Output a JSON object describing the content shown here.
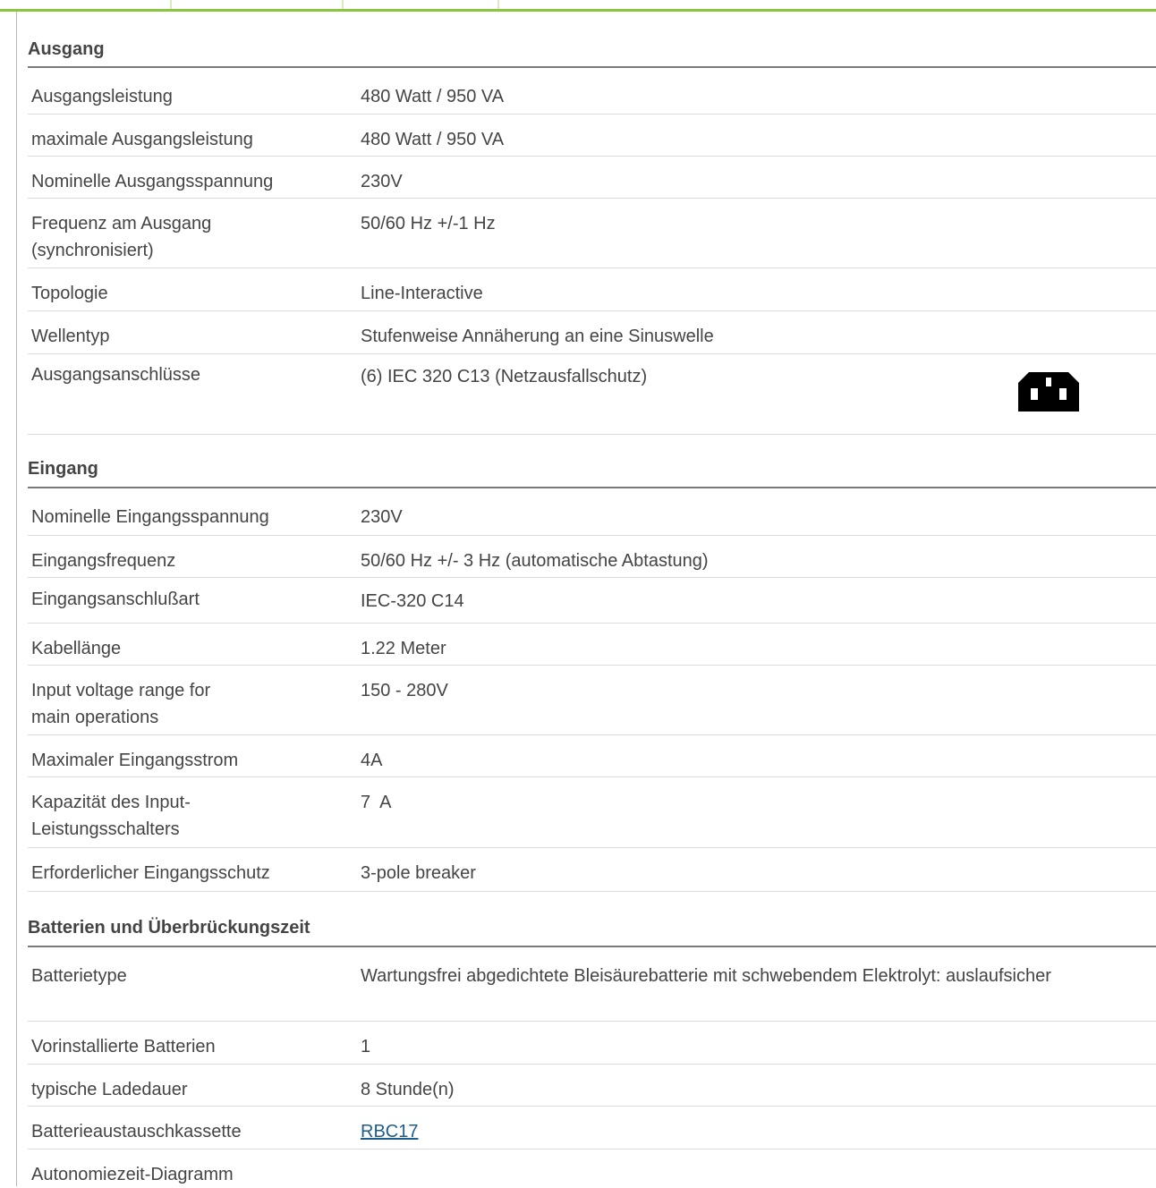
{
  "sections": [
    {
      "title": "Ausgang",
      "rows": [
        {
          "label": "Ausgangsleistung",
          "value": "480 Watt / 950 VA"
        },
        {
          "label": "maximale Ausgangsleistung",
          "value": "480 Watt / 950 VA"
        },
        {
          "label": "Nominelle Ausgangsspannung",
          "value": "230V"
        },
        {
          "label": "Frequenz am Ausgang (synchronisiert)",
          "value": "50/60 Hz +/-1 Hz"
        },
        {
          "label": "Topologie",
          "value": "Line-Interactive"
        },
        {
          "label": "Wellentyp",
          "value": "Stufenweise Annäherung an eine Sinuswelle"
        },
        {
          "label": "Ausgangsanschlüsse",
          "value": "(6) IEC 320 C13 (Netzausfallschutz)",
          "icon": "iec-c13-outlet-icon"
        }
      ]
    },
    {
      "title": "Eingang",
      "rows": [
        {
          "label": "Nominelle Eingangsspannung",
          "value": "230V"
        },
        {
          "label": "Eingangsfrequenz",
          "value": "50/60 Hz +/- 3 Hz (automatische Abtastung)"
        },
        {
          "label": "Eingangsanschlußart",
          "value": "IEC-320 C14"
        },
        {
          "label": "Kabellänge",
          "value": "1.22 Meter"
        },
        {
          "label": "Input voltage range for main operations",
          "value": "150 - 280V"
        },
        {
          "label": "Maximaler Eingangsstrom",
          "value": "4A"
        },
        {
          "label": "Kapazität des Input-Leistungsschalters",
          "value": "7  A"
        },
        {
          "label": "Erforderlicher Eingangsschutz",
          "value": "3-pole breaker"
        }
      ]
    },
    {
      "title": "Batterien und Überbrückungszeit",
      "rows": [
        {
          "label": "Batterietype",
          "value": "Wartungsfrei abgedichtete Bleisäurebatterie mit schwebendem Elektrolyt: auslaufsicher"
        },
        {
          "label": "Vorinstallierte Batterien",
          "value": "1"
        },
        {
          "label": "typische Ladedauer",
          "value": "8 Stunde(n)"
        },
        {
          "label": "Batterieaustauschkassette",
          "value": "RBC17",
          "link": true
        },
        {
          "label": "Autonomiezeit-Diagramm",
          "value": ""
        }
      ]
    }
  ],
  "colors": {
    "accent": "#8cc63f",
    "link": "#1f5d8f",
    "text": "#444444"
  }
}
